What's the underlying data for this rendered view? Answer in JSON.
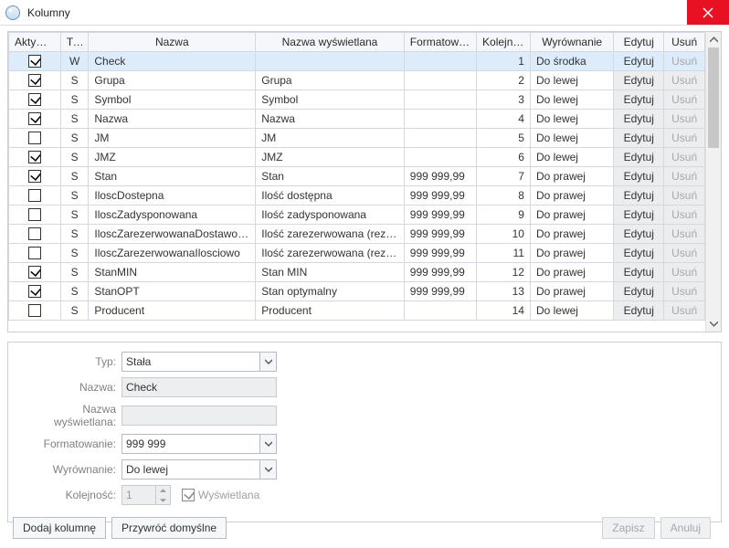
{
  "window": {
    "title": "Kolumny"
  },
  "columns": {
    "aktywne": "Aktywne",
    "typ": "Typ",
    "nazwa": "Nazwa",
    "nazwaw": "Nazwa wyświetlana",
    "format": "Formatowa...",
    "kolej": "Kolejność",
    "wyrow": "Wyrównanie",
    "edit": "Edytuj",
    "del": "Usuń"
  },
  "rows": [
    {
      "active": true,
      "typ": "W",
      "nazwa": "Check",
      "nazwaw": "",
      "format": "",
      "kolej": "1",
      "wyrow": "Do środka",
      "sel": true
    },
    {
      "active": true,
      "typ": "S",
      "nazwa": "Grupa",
      "nazwaw": "Grupa",
      "format": "",
      "kolej": "2",
      "wyrow": "Do lewej"
    },
    {
      "active": true,
      "typ": "S",
      "nazwa": "Symbol",
      "nazwaw": "Symbol",
      "format": "",
      "kolej": "3",
      "wyrow": "Do lewej"
    },
    {
      "active": true,
      "typ": "S",
      "nazwa": "Nazwa",
      "nazwaw": "Nazwa",
      "format": "",
      "kolej": "4",
      "wyrow": "Do lewej"
    },
    {
      "active": false,
      "typ": "S",
      "nazwa": "JM",
      "nazwaw": "JM",
      "format": "",
      "kolej": "5",
      "wyrow": "Do lewej"
    },
    {
      "active": true,
      "typ": "S",
      "nazwa": "JMZ",
      "nazwaw": "JMZ",
      "format": "",
      "kolej": "6",
      "wyrow": "Do lewej"
    },
    {
      "active": true,
      "typ": "S",
      "nazwa": "Stan",
      "nazwaw": "Stan",
      "format": "999 999,99",
      "kolej": "7",
      "wyrow": "Do prawej"
    },
    {
      "active": false,
      "typ": "S",
      "nazwa": "IloscDostepna",
      "nazwaw": "Ilość dostępna",
      "format": "999 999,99",
      "kolej": "8",
      "wyrow": "Do prawej"
    },
    {
      "active": false,
      "typ": "S",
      "nazwa": "IloscZadysponowana",
      "nazwaw": "Ilość zadysponowana",
      "format": "999 999,99",
      "kolej": "9",
      "wyrow": "Do prawej"
    },
    {
      "active": false,
      "typ": "S",
      "nazwa": "IloscZarezerwowanaDostawowo",
      "nazwaw": "Ilość zarezerwowana (rezerw...",
      "format": "999 999,99",
      "kolej": "10",
      "wyrow": "Do prawej"
    },
    {
      "active": false,
      "typ": "S",
      "nazwa": "IloscZarezerwowanaIlosciowo",
      "nazwaw": "Ilość zarezerwowana (rezerw...",
      "format": "999 999,99",
      "kolej": "11",
      "wyrow": "Do prawej"
    },
    {
      "active": true,
      "typ": "S",
      "nazwa": "StanMIN",
      "nazwaw": "Stan MIN",
      "format": "999 999,99",
      "kolej": "12",
      "wyrow": "Do prawej"
    },
    {
      "active": true,
      "typ": "S",
      "nazwa": "StanOPT",
      "nazwaw": "Stan optymalny",
      "format": "999 999,99",
      "kolej": "13",
      "wyrow": "Do prawej"
    },
    {
      "active": false,
      "typ": "S",
      "nazwa": "Producent",
      "nazwaw": "Producent",
      "format": "",
      "kolej": "14",
      "wyrow": "Do lewej"
    }
  ],
  "row_buttons": {
    "edit": "Edytuj",
    "del": "Usuń"
  },
  "form": {
    "typ_label": "Typ:",
    "typ_value": "Stała",
    "nazwa_label": "Nazwa:",
    "nazwa_value": "Check",
    "nazwaw_label": "Nazwa wyświetlana:",
    "nazwaw_value": "",
    "format_label": "Formatowanie:",
    "format_value": "999 999",
    "wyrow_label": "Wyrównanie:",
    "wyrow_value": "Do lewej",
    "kolej_label": "Kolejność:",
    "kolej_value": "1",
    "wysw_label": "Wyświetlana"
  },
  "buttons": {
    "add": "Dodaj kolumnę",
    "restore": "Przywróć domyślne",
    "save": "Zapisz",
    "cancel": "Anuluj"
  }
}
